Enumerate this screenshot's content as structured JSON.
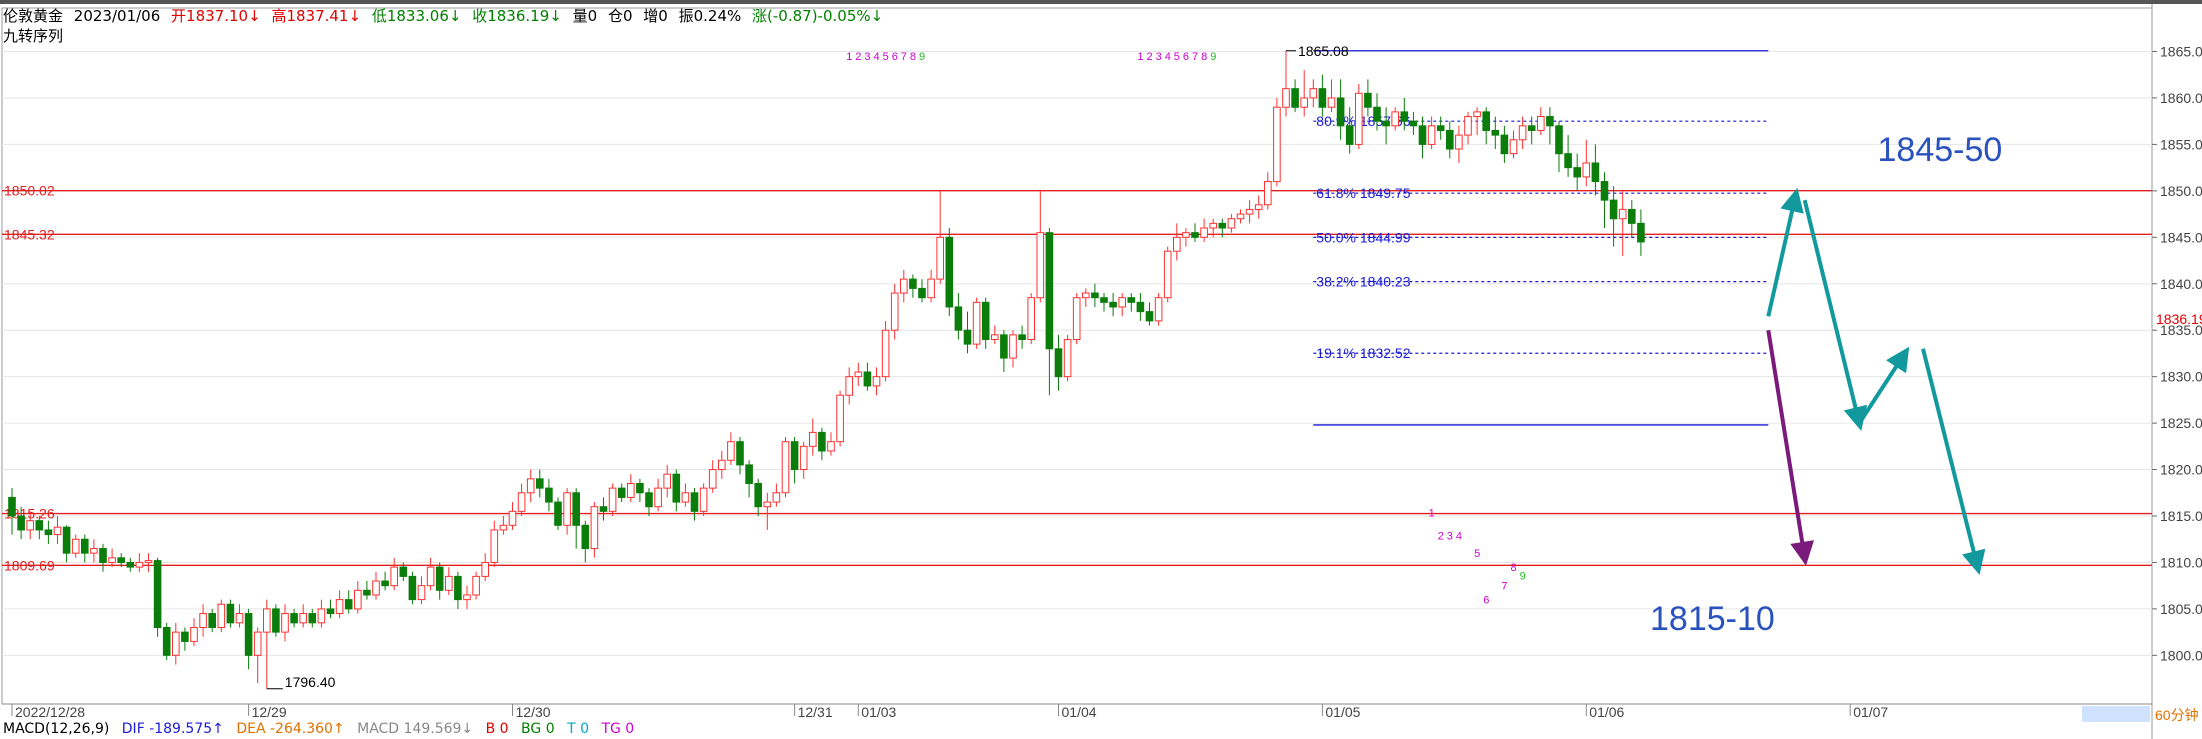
{
  "header": {
    "symbol": "伦敦黄金",
    "date": "2023/01/06",
    "open": "开1837.10↓",
    "high": "高1837.41↓",
    "low": "低1833.06↓",
    "close": "收1836.19↓",
    "volume": "量0",
    "position": "仓0",
    "increase": "增0",
    "amplitude": "振0.24%",
    "change": "涨(-0.87)-0.05%↓",
    "indicator": "九转序列"
  },
  "macd": {
    "label": "MACD(12,26,9)",
    "dif": "DIF -189.575↑",
    "dea": "DEA -264.360↑",
    "macd": "MACD 149.569↓",
    "b": "B 0",
    "bg": "BG 0",
    "t": "T 0",
    "tg": "TG 0"
  },
  "timeframe": "60分钟",
  "colors": {
    "up": "#ff3030",
    "down": "#0a7d0a",
    "fib": "#1a1ad8",
    "hline": "#e02020",
    "arrow_teal": "#11999e",
    "arrow_purple": "#7a1a7a",
    "target_text": "#2a52be"
  },
  "chart_data": {
    "type": "candlestick",
    "instrument": "伦敦黄金",
    "interval": "60分钟",
    "ylim": [
      1795,
      1867
    ],
    "y_ticks": [
      1800,
      1805,
      1810,
      1815,
      1820,
      1825,
      1830,
      1835,
      1840,
      1845,
      1850,
      1855,
      1860,
      1865
    ],
    "y_tick_labels": [
      "1800.00",
      "1805.00",
      "1810.00",
      "1815.00",
      "1820.00",
      "1825.00",
      "1830.00",
      "1835.00",
      "1840.00",
      "1845.00",
      "1850.00",
      "1855.00",
      "1860.00",
      "1865.00"
    ],
    "x_labels": [
      {
        "label": "2022/12/28",
        "bar": 0
      },
      {
        "label": "12/29",
        "bar": 26
      },
      {
        "label": "12/30",
        "bar": 55
      },
      {
        "label": "12/31",
        "bar": 86
      },
      {
        "label": "01/03",
        "bar": 93
      },
      {
        "label": "01/04",
        "bar": 115
      },
      {
        "label": "01/05",
        "bar": 144
      },
      {
        "label": "01/06",
        "bar": 173
      },
      {
        "label": "01/07",
        "bar": 202
      }
    ],
    "last_price": 1836.19,
    "last_price_label": "1836.19",
    "high_label": "1865.08",
    "low_label": "1796.40",
    "horizontal_lines": [
      {
        "value": 1850.02,
        "label": "1850.02"
      },
      {
        "value": 1845.32,
        "label": "1845.32"
      },
      {
        "value": 1815.26,
        "label": "1815.26"
      },
      {
        "value": 1809.69,
        "label": "1809.69"
      }
    ],
    "fibonacci": {
      "start_bar": 143,
      "end_bar": 193,
      "high": 1865.08,
      "low": 1824.8,
      "levels": [
        {
          "value": 1857.5,
          "label": "80.9% 1857.66",
          "dashed": true
        },
        {
          "value": 1849.75,
          "label": "61.8% 1849.75",
          "dashed": true
        },
        {
          "value": 1844.99,
          "label": "50.0% 1844.99",
          "dashed": true
        },
        {
          "value": 1840.23,
          "label": "38.2% 1840.23",
          "dashed": true
        },
        {
          "value": 1832.52,
          "label": "19.1% 1832.52",
          "dashed": true
        }
      ]
    },
    "targets": [
      {
        "label": "1845-50",
        "bar": 205,
        "value": 1854.5
      },
      {
        "label": "1815-10",
        "bar": 180,
        "value": 1804
      }
    ],
    "arrows": [
      {
        "color": "teal",
        "from": [
          193,
          1836.5
        ],
        "to": [
          196,
          1849.5
        ]
      },
      {
        "color": "teal",
        "from": [
          197,
          1849
        ],
        "to": [
          203,
          1825
        ]
      },
      {
        "color": "teal",
        "from": [
          203,
          1825
        ],
        "to": [
          208,
          1832.5
        ]
      },
      {
        "color": "teal",
        "from": [
          210,
          1833
        ],
        "to": [
          216,
          1809.5
        ]
      },
      {
        "color": "purple",
        "from": [
          193,
          1835
        ],
        "to": [
          197,
          1810.5
        ]
      }
    ],
    "td_sequences": [
      {
        "start_bar": 92,
        "value": 1864.5,
        "digits": [
          1,
          2,
          3,
          4,
          5,
          6,
          7,
          8,
          9
        ],
        "colors": [
          "m",
          "m",
          "m",
          "m",
          "m",
          "m",
          "m",
          "m",
          "g"
        ]
      },
      {
        "start_bar": 124,
        "value": 1864.5,
        "digits": [
          1,
          2,
          3,
          4,
          5,
          6,
          7,
          8,
          9
        ],
        "colors": [
          "m",
          "m",
          "m",
          "m",
          "m",
          "m",
          "m",
          "m",
          "g"
        ]
      },
      {
        "start_bar": 156,
        "value": 1815.4,
        "digits": [
          1
        ],
        "colors": [
          "m"
        ]
      },
      {
        "start_bar": 157,
        "value": 1812.9,
        "digits": [
          2,
          3,
          4
        ],
        "colors": [
          "m",
          "m",
          "m"
        ]
      },
      {
        "start_bar": 161,
        "value": 1811.0,
        "digits": [
          5
        ],
        "colors": [
          "m"
        ]
      },
      {
        "start_bar": 165,
        "value": 1809.5,
        "digits": [
          8
        ],
        "colors": [
          "m"
        ]
      },
      {
        "start_bar": 166,
        "value": 1808.6,
        "digits": [
          9
        ],
        "colors": [
          "g"
        ]
      },
      {
        "start_bar": 164,
        "value": 1807.5,
        "digits": [
          7
        ],
        "colors": [
          "m"
        ]
      },
      {
        "start_bar": 162,
        "value": 1806.0,
        "digits": [
          6
        ],
        "colors": [
          "m"
        ]
      }
    ],
    "candles": [
      [
        1817,
        1815,
        1818,
        1813
      ],
      [
        1815,
        1813.5,
        1816,
        1812.5
      ],
      [
        1813.5,
        1814.5,
        1815.5,
        1812.5
      ],
      [
        1814.5,
        1813.5,
        1815,
        1812.5
      ],
      [
        1813.5,
        1813,
        1814.5,
        1812
      ],
      [
        1813,
        1813.8,
        1815,
        1812
      ],
      [
        1813.8,
        1811,
        1814,
        1810
      ],
      [
        1811,
        1812.5,
        1813,
        1810.5
      ],
      [
        1812.5,
        1811,
        1813,
        1810
      ],
      [
        1811,
        1811.5,
        1812.5,
        1810
      ],
      [
        1811.5,
        1810,
        1812,
        1809
      ],
      [
        1810,
        1810.5,
        1811.5,
        1809.5
      ],
      [
        1810.5,
        1810,
        1811,
        1809.5
      ],
      [
        1810,
        1809.5,
        1810.5,
        1809
      ],
      [
        1809.5,
        1810,
        1811,
        1809
      ],
      [
        1810,
        1810.2,
        1811,
        1809
      ],
      [
        1810.2,
        1803,
        1810.5,
        1802
      ],
      [
        1803,
        1800,
        1803.5,
        1799.5
      ],
      [
        1800,
        1802.5,
        1803.5,
        1799
      ],
      [
        1802.5,
        1801.5,
        1803,
        1800.5
      ],
      [
        1801.5,
        1803,
        1804,
        1801
      ],
      [
        1803,
        1804.5,
        1805.5,
        1802
      ],
      [
        1804.5,
        1803,
        1805,
        1802.5
      ],
      [
        1803,
        1805.5,
        1806,
        1802.5
      ],
      [
        1805.5,
        1803.5,
        1806,
        1803
      ],
      [
        1803.5,
        1804.5,
        1805.5,
        1803
      ],
      [
        1804.5,
        1800,
        1805,
        1798.5
      ],
      [
        1800,
        1802.5,
        1803,
        1797
      ],
      [
        1802.5,
        1805,
        1806,
        1796.4
      ],
      [
        1805,
        1802.5,
        1805.5,
        1802
      ],
      [
        1802.5,
        1804.5,
        1805.5,
        1801.5
      ],
      [
        1804.5,
        1803.5,
        1805,
        1803
      ],
      [
        1803.5,
        1804.5,
        1805.5,
        1803
      ],
      [
        1804.5,
        1803.5,
        1805,
        1803
      ],
      [
        1803.5,
        1805,
        1806,
        1803
      ],
      [
        1805,
        1804.5,
        1806,
        1804
      ],
      [
        1804.5,
        1806,
        1807,
        1804
      ],
      [
        1806,
        1805,
        1807,
        1804.5
      ],
      [
        1805,
        1807,
        1808,
        1804.5
      ],
      [
        1807,
        1806.5,
        1808,
        1806
      ],
      [
        1806.5,
        1808,
        1809,
        1806
      ],
      [
        1808,
        1807.5,
        1809,
        1807
      ],
      [
        1807.5,
        1809.5,
        1810.5,
        1807
      ],
      [
        1809.5,
        1808.5,
        1810,
        1808
      ],
      [
        1808.5,
        1806,
        1809,
        1805.5
      ],
      [
        1806,
        1807.5,
        1808.5,
        1805.5
      ],
      [
        1807.5,
        1809.5,
        1810.5,
        1807
      ],
      [
        1809.5,
        1807,
        1810,
        1806
      ],
      [
        1807,
        1808.5,
        1809.5,
        1806.5
      ],
      [
        1808.5,
        1806,
        1809,
        1805
      ],
      [
        1806,
        1806.5,
        1807.5,
        1805
      ],
      [
        1806.5,
        1808.5,
        1809,
        1806
      ],
      [
        1808.5,
        1810,
        1811,
        1808
      ],
      [
        1810,
        1813.5,
        1814.5,
        1809.5
      ],
      [
        1813.5,
        1814,
        1815,
        1813
      ],
      [
        1814,
        1815.5,
        1816.5,
        1813.5
      ],
      [
        1815.5,
        1817.5,
        1818.5,
        1815
      ],
      [
        1817.5,
        1819,
        1820,
        1816.5
      ],
      [
        1819,
        1818,
        1820,
        1817
      ],
      [
        1818,
        1816.5,
        1819,
        1815.5
      ],
      [
        1816.5,
        1814,
        1817,
        1813.5
      ],
      [
        1814,
        1817.5,
        1818,
        1813
      ],
      [
        1817.5,
        1814,
        1818,
        1811.5
      ],
      [
        1814,
        1811.5,
        1814.5,
        1810
      ],
      [
        1811.5,
        1816,
        1816.5,
        1810.5
      ],
      [
        1816,
        1815.5,
        1817,
        1814.5
      ],
      [
        1815.5,
        1818,
        1818.5,
        1815
      ],
      [
        1818,
        1817,
        1818.5,
        1816.5
      ],
      [
        1817,
        1818.5,
        1819.5,
        1816.5
      ],
      [
        1818.5,
        1817.5,
        1819,
        1816.5
      ],
      [
        1817.5,
        1816,
        1818,
        1815
      ],
      [
        1816,
        1818,
        1819,
        1815.5
      ],
      [
        1818,
        1819.5,
        1820.5,
        1817
      ],
      [
        1819.5,
        1816.5,
        1820,
        1815.5
      ],
      [
        1816.5,
        1817.5,
        1818.5,
        1816
      ],
      [
        1817.5,
        1815.5,
        1818,
        1814.5
      ],
      [
        1815.5,
        1818,
        1818.5,
        1815
      ],
      [
        1818,
        1820,
        1821,
        1817.5
      ],
      [
        1820,
        1821,
        1822,
        1819
      ],
      [
        1821,
        1823,
        1824,
        1820.5
      ],
      [
        1823,
        1820.5,
        1823.5,
        1819.5
      ],
      [
        1820.5,
        1818.5,
        1821,
        1817
      ],
      [
        1818.5,
        1816,
        1819,
        1815
      ],
      [
        1816,
        1816.5,
        1817.5,
        1813.5
      ],
      [
        1816.5,
        1817.5,
        1818.5,
        1816
      ],
      [
        1817.5,
        1823,
        1823.5,
        1817
      ],
      [
        1823,
        1820,
        1823.5,
        1818.5
      ],
      [
        1820,
        1822.5,
        1823,
        1819
      ],
      [
        1822.5,
        1824,
        1825.5,
        1821.5
      ],
      [
        1824,
        1822,
        1824.5,
        1821
      ],
      [
        1822,
        1823,
        1824,
        1821.5
      ],
      [
        1823,
        1828,
        1828.5,
        1822.5
      ],
      [
        1828,
        1830,
        1831,
        1827
      ],
      [
        1830,
        1830.5,
        1831.5,
        1829
      ],
      [
        1830.5,
        1829,
        1831.5,
        1828.5
      ],
      [
        1829,
        1830,
        1831,
        1828
      ],
      [
        1830,
        1835,
        1836,
        1829.5
      ],
      [
        1835,
        1839,
        1840,
        1834
      ],
      [
        1839,
        1840.5,
        1841.5,
        1838
      ],
      [
        1840.5,
        1839.5,
        1841,
        1838.5
      ],
      [
        1839.5,
        1838.5,
        1840.5,
        1838
      ],
      [
        1838.5,
        1840.5,
        1841.5,
        1838
      ],
      [
        1840.5,
        1845,
        1850,
        1840
      ],
      [
        1845,
        1837.5,
        1846,
        1836.5
      ],
      [
        1837.5,
        1835,
        1839,
        1834
      ],
      [
        1835,
        1833.5,
        1837,
        1832.5
      ],
      [
        1833.5,
        1838,
        1838.5,
        1833
      ],
      [
        1838,
        1834,
        1838.5,
        1833
      ],
      [
        1834,
        1834.5,
        1835.5,
        1833.5
      ],
      [
        1834.5,
        1832,
        1835,
        1830.5
      ],
      [
        1832,
        1834.5,
        1835,
        1831
      ],
      [
        1834.5,
        1834,
        1835.5,
        1833
      ],
      [
        1834,
        1838.5,
        1839,
        1833.5
      ],
      [
        1838.5,
        1845.5,
        1850,
        1838
      ],
      [
        1845.5,
        1833,
        1846,
        1828
      ],
      [
        1833,
        1830,
        1834.5,
        1828.5
      ],
      [
        1830,
        1834,
        1834.5,
        1829.5
      ],
      [
        1834,
        1838.5,
        1839,
        1833.5
      ],
      [
        1838.5,
        1839,
        1839.5,
        1837.5
      ],
      [
        1839,
        1838.5,
        1840,
        1837.5
      ],
      [
        1838.5,
        1838,
        1839,
        1837
      ],
      [
        1838,
        1837.5,
        1839,
        1836.5
      ],
      [
        1837.5,
        1838.5,
        1839,
        1836.5
      ],
      [
        1838.5,
        1838,
        1839,
        1837
      ],
      [
        1838,
        1837,
        1839,
        1836
      ],
      [
        1837,
        1836,
        1838,
        1835.5
      ],
      [
        1836,
        1838.5,
        1839,
        1835.5
      ],
      [
        1838.5,
        1843.5,
        1844,
        1838
      ],
      [
        1843.5,
        1845,
        1846.5,
        1842.5
      ],
      [
        1845,
        1845.5,
        1846,
        1844
      ],
      [
        1845.5,
        1845,
        1846.5,
        1844.5
      ],
      [
        1845,
        1846,
        1847,
        1844.5
      ],
      [
        1846,
        1846.5,
        1847,
        1845
      ],
      [
        1846.5,
        1846,
        1847,
        1845
      ],
      [
        1846,
        1847,
        1847.5,
        1845.5
      ],
      [
        1847,
        1847.5,
        1848,
        1846.5
      ],
      [
        1847.5,
        1848,
        1849,
        1846.5
      ],
      [
        1848,
        1848.5,
        1849.5,
        1847
      ],
      [
        1848.5,
        1851,
        1852,
        1848
      ],
      [
        1851,
        1859,
        1860,
        1850.5
      ],
      [
        1859,
        1861,
        1865.08,
        1858
      ],
      [
        1861,
        1859,
        1862,
        1858.5
      ],
      [
        1859,
        1860,
        1863,
        1858
      ],
      [
        1860,
        1861,
        1862,
        1859
      ],
      [
        1861,
        1859,
        1862.5,
        1858
      ],
      [
        1859,
        1860,
        1862,
        1858.5
      ],
      [
        1860,
        1857,
        1862,
        1855.5
      ],
      [
        1857,
        1855,
        1859,
        1854
      ],
      [
        1855,
        1860.5,
        1861.5,
        1854.5
      ],
      [
        1860.5,
        1859,
        1862,
        1858
      ],
      [
        1859,
        1857.5,
        1860.5,
        1856.5
      ],
      [
        1857.5,
        1857,
        1859,
        1855
      ],
      [
        1857,
        1858.5,
        1859,
        1856.5
      ],
      [
        1858.5,
        1857.5,
        1860,
        1856.5
      ],
      [
        1857.5,
        1857,
        1858.5,
        1856
      ],
      [
        1857,
        1855,
        1858,
        1853.5
      ],
      [
        1855,
        1857,
        1858,
        1854.5
      ],
      [
        1857,
        1856.5,
        1858,
        1855.5
      ],
      [
        1856.5,
        1854.5,
        1857.5,
        1853.5
      ],
      [
        1854.5,
        1856,
        1857,
        1853
      ],
      [
        1856,
        1858,
        1858.5,
        1855
      ],
      [
        1858,
        1858.5,
        1859,
        1856
      ],
      [
        1858.5,
        1856.5,
        1859,
        1855
      ],
      [
        1856.5,
        1856,
        1858,
        1854.5
      ],
      [
        1856,
        1854,
        1857,
        1853
      ],
      [
        1854,
        1855.5,
        1856.5,
        1853.5
      ],
      [
        1855.5,
        1857,
        1858,
        1854.5
      ],
      [
        1857,
        1856.5,
        1858,
        1855
      ],
      [
        1856.5,
        1858,
        1859,
        1856
      ],
      [
        1858,
        1857,
        1859,
        1855
      ],
      [
        1857,
        1854,
        1857.5,
        1852
      ],
      [
        1854,
        1852.5,
        1856,
        1851.5
      ],
      [
        1852.5,
        1851.5,
        1854,
        1850
      ],
      [
        1851.5,
        1853,
        1855.5,
        1850.5
      ],
      [
        1853,
        1851,
        1855,
        1849.5
      ],
      [
        1851,
        1849,
        1852,
        1846
      ],
      [
        1849,
        1847,
        1850.5,
        1844
      ],
      [
        1847,
        1848,
        1850,
        1843
      ],
      [
        1848,
        1846.5,
        1849,
        1845
      ],
      [
        1846.5,
        1844.5,
        1848,
        1843
      ]
    ]
  }
}
